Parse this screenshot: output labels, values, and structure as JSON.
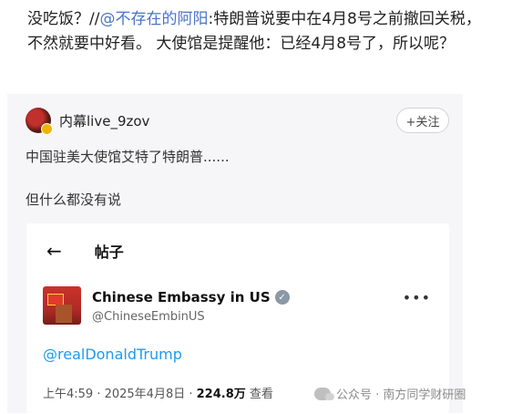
{
  "post": {
    "text_a": "没吃饭？//",
    "mention": "@不存在的阿阳",
    "text_b": ":特朗普说要中在4月8号之前撤回关税，不然就要中好看。 大使馆是提醒他：已经4月8号了，所以呢？"
  },
  "card": {
    "username": "内幕live_9zov",
    "follow_label": "+关注",
    "line1": "中国驻美大使馆艾特了特朗普......",
    "line2": "但什么都没有说"
  },
  "tweet": {
    "page_title": "帖子",
    "display_name": "Chinese Embassy in US",
    "handle": "@ChineseEmbinUS",
    "mention": "@realDonaldTrump",
    "meta_time": "上午4:59 · 2025年4月8日 · ",
    "views": "224.8万",
    "views_label": " 查看"
  },
  "watermark": {
    "text": "公众号 · 南方同学财研圈"
  },
  "icons": {
    "back": "back-arrow-icon",
    "verified": "verified-badge-icon",
    "more": "more-options-icon",
    "wechat": "wechat-icon"
  }
}
